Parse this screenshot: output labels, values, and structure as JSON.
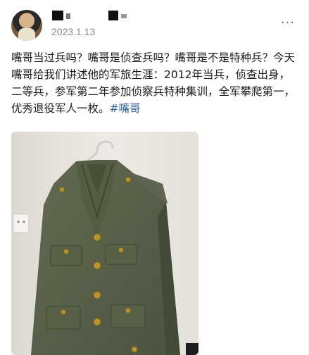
{
  "post": {
    "date": "2023.1.13",
    "more_icon": "···",
    "text": "嘴哥当过兵吗？嘴哥是侦查兵吗？嘴哥是不是特种兵？今天嘴哥给我们讲述他的军旅生涯：2012年当兵，侦查出身，二等兵，参军第二年参加侦察兵特种集训，全军攀爬第一，优秀退役军人一枚。",
    "hashtag": "#嘴哥"
  },
  "colors": {
    "hashtag": "#2b5fa8",
    "uniform": "#5a6148",
    "button": "#b8942c"
  },
  "icons": [
    "avatar",
    "more-options-icon",
    "wall-outlet-icon",
    "hanger-icon"
  ]
}
